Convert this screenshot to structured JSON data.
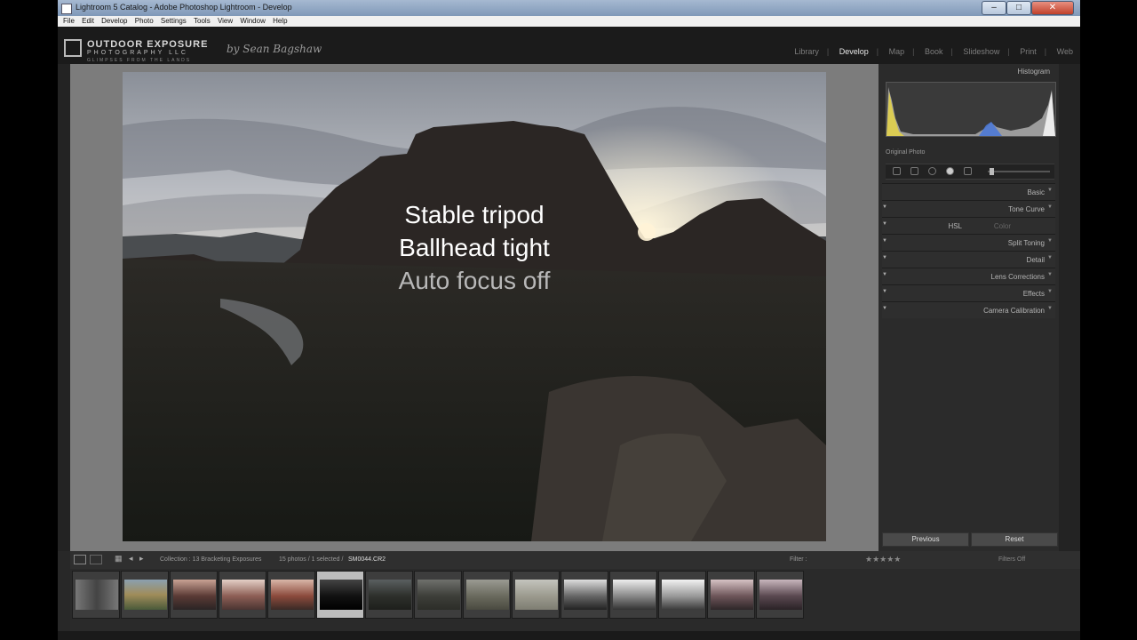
{
  "window": {
    "title": "Lightroom 5 Catalog - Adobe Photoshop Lightroom - Develop",
    "buttons": {
      "minimize": "–",
      "maximize": "□",
      "close": "✕"
    }
  },
  "menu": [
    "File",
    "Edit",
    "Develop",
    "Photo",
    "Settings",
    "Tools",
    "View",
    "Window",
    "Help"
  ],
  "identity_plate": {
    "line1": "OUTDOOR EXPOSURE",
    "line2": "PHOTOGRAPHY LLC",
    "line3": "GLIMPSES FROM THE LANDS",
    "byline": "by Sean Bagshaw"
  },
  "modules": [
    "Library",
    "Develop",
    "Map",
    "Book",
    "Slideshow",
    "Print",
    "Web"
  ],
  "active_module": "Develop",
  "overlay_text": {
    "line1": "Stable tripod",
    "line2": "Ballhead tight",
    "line3": "Auto focus off"
  },
  "right_panel": {
    "histogram_label": "Histogram",
    "histogram_meta": [
      "",
      "",
      "",
      ""
    ],
    "original_photo": "Original Photo",
    "sections": [
      "Basic",
      "Tone Curve",
      "HSL",
      "Split Toning",
      "Detail",
      "Lens Corrections",
      "Effects",
      "Camera Calibration"
    ],
    "hsl_extra": "Color",
    "previous_button": "Previous",
    "reset_button": "Reset"
  },
  "filmstrip_bar": {
    "source": "Collection : 13 Bracketing Exposures",
    "count": "15 photos / 1 selected /",
    "filename": "SM0044.CR2",
    "filter_label": "Filter :",
    "filter_value": "Filters Off",
    "rating": "★★★★★"
  },
  "filmstrip": {
    "thumbnail_count": 15,
    "selected_index": 5
  },
  "colors": {
    "panel_bg": "#2b2b2b",
    "canvas_bg": "#7c7c7c",
    "active_module": "#e6e6e6",
    "overlay_primary": "#ffffff",
    "overlay_secondary": "#b8b8b8"
  }
}
